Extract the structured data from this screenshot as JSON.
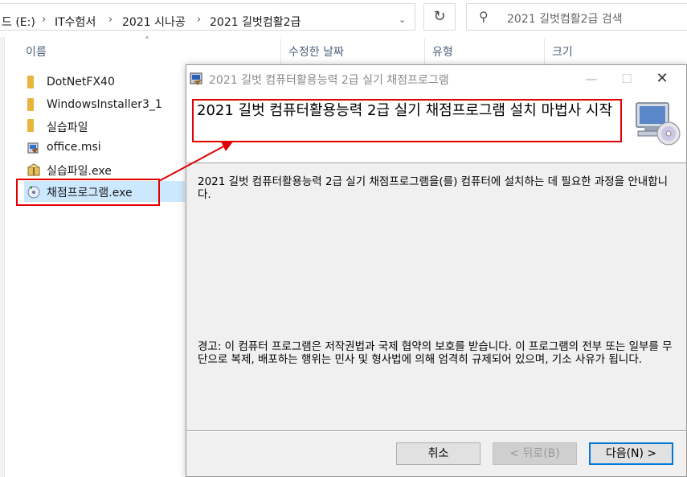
{
  "explorer": {
    "breadcrumb": [
      "드 (E:)",
      "IT수험서",
      "2021 시나공",
      "2021 길벗컴활2급"
    ],
    "search_placeholder": "2021 길벗컴활2급 검색",
    "columns": [
      "이름",
      "수정한 날짜",
      "유형",
      "크기"
    ],
    "files": [
      {
        "name": "DotNetFX40",
        "kind": "folder"
      },
      {
        "name": "WindowsInstaller3_1",
        "kind": "folder"
      },
      {
        "name": "실습파일",
        "kind": "folder"
      },
      {
        "name": "office.msi",
        "kind": "msi"
      },
      {
        "name": "실습파일.exe",
        "kind": "exe-archive"
      },
      {
        "name": "채점프로그램.exe",
        "kind": "exe-setup",
        "selected": true
      }
    ]
  },
  "dialog": {
    "title": "2021 길벗 컴퓨터활용능력 2급 실기 채점프로그램",
    "heading": "2021 길벗 컴퓨터활용능력 2급 실기 채점프로그램 설치 마법사 시작",
    "intro": "2021 길벗 컴퓨터활용능력 2급 실기 채점프로그램을(를) 컴퓨터에 설치하는 데 필요한 과정을 안내합니다.",
    "warning": "경고: 이 컴퓨터 프로그램은 저작권법과 국제 협약의 보호를 받습니다. 이 프로그램의 전부 또는 일부를 무단으로 복제, 배포하는 행위는 민사 및 형사법에 의해 엄격히 규제되어 있으며, 기소 사유가 됩니다.",
    "buttons": {
      "cancel": "취소",
      "back": "< 뒤로(B)",
      "next": "다음(N) >"
    }
  },
  "colors": {
    "annotation": "#e00000",
    "selection": "#cce8ff"
  }
}
